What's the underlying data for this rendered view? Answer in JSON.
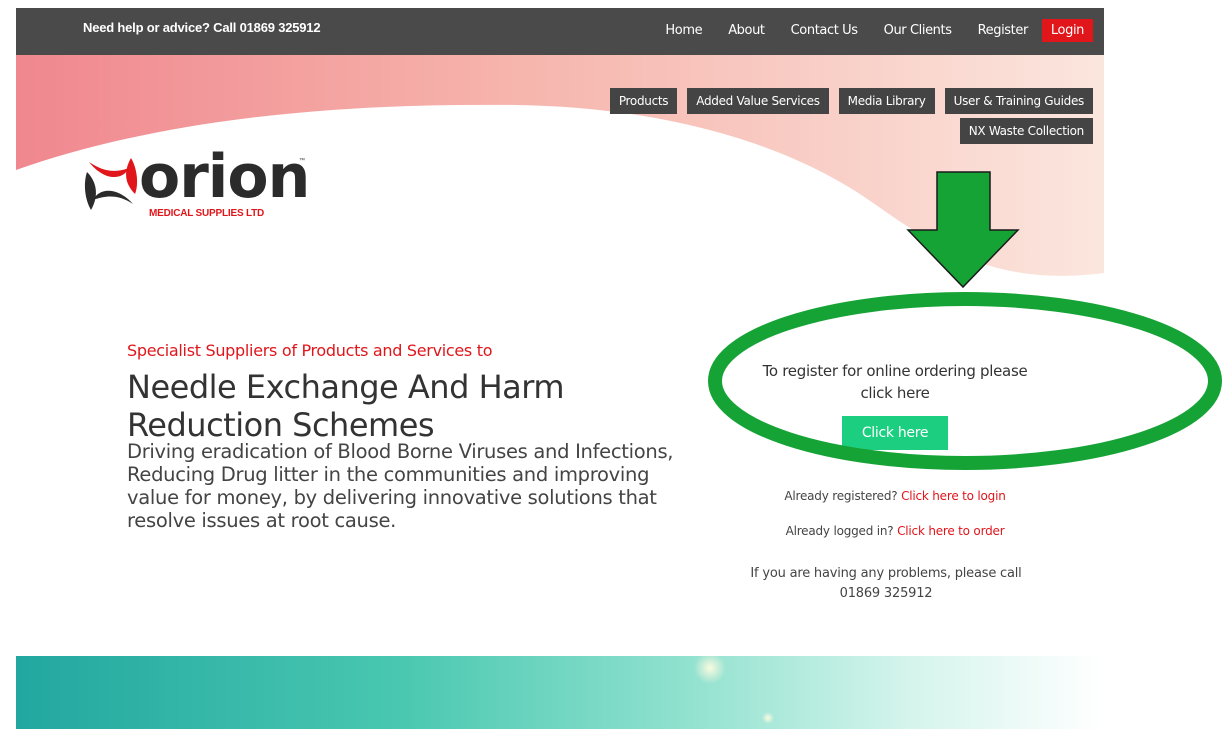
{
  "topbar": {
    "help_text": "Need help or advice? Call 01869 325912",
    "nav": [
      "Home",
      "About",
      "Contact Us",
      "Our Clients",
      "Register"
    ],
    "login_label": "Login"
  },
  "main_nav": [
    "Products",
    "Added Value Services",
    "Media Library",
    "User & Training Guides",
    "NX Waste Collection"
  ],
  "logo": {
    "brand": "orion",
    "tm": "™",
    "subtitle": "MEDICAL SUPPLIES LTD"
  },
  "hero": {
    "tagline": "Specialist Suppliers of Products and Services to",
    "headline": "Needle Exchange And Harm Reduction Schemes",
    "description": "Driving eradication of Blood Borne Viruses and Infections, Reducing Drug litter in the communities and improving value for money, by delivering innovative solutions that resolve issues at root cause."
  },
  "register": {
    "prompt": "To register for online ordering please click here",
    "button_label": "Click here",
    "registered_prefix": "Already registered?",
    "registered_link": "Click here to login",
    "logged_in_prefix": "Already logged in?",
    "logged_in_link": "Click here to order",
    "problems_text": "If you are having any problems, please call 01869 325912"
  },
  "colors": {
    "topbar": "#4a4a4a",
    "brand_red": "#e0161b",
    "cta_green": "#1ccf80",
    "annotation_green": "#16a336",
    "nav_button": "#444444"
  }
}
